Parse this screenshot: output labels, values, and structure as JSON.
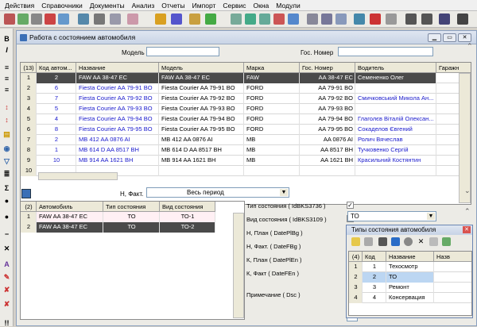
{
  "menu": [
    "Действия",
    "Справочники",
    "Документы",
    "Анализ",
    "Отчеты",
    "Импорт",
    "Сервис",
    "Окна",
    "Модули"
  ],
  "window": {
    "title": "Работа с состоянием автомобиля"
  },
  "filters": {
    "model_label": "Модель",
    "gos_label": "Гос. Номер",
    "model_value": "",
    "gos_value": ""
  },
  "main_grid": {
    "count": "(13)",
    "columns": [
      "Код автом...",
      "Название",
      "Модель",
      "Марка",
      "Гос. Номер",
      "Водитель",
      "Гаражн"
    ],
    "rows": [
      [
        "1",
        "2",
        "FAW AA 38-47 EC",
        "FAW AA 38-47 EC",
        "FAW",
        "AA 38-47 EC",
        "Семененко Олег"
      ],
      [
        "2",
        "6",
        "Fiesta Courier AA 79-91 BO",
        "Fiesta Courier AA 79-91 BO",
        "FORD",
        "AA 79-91 BO",
        ""
      ],
      [
        "3",
        "7",
        "Fiesta Courier AA 79-92 BO",
        "Fiesta Courier AA 79-92 BO",
        "FORD",
        "AA 79-92 BO",
        "Смичковський Микола Ан..."
      ],
      [
        "4",
        "5",
        "Fiesta Courier AA 79-93 BO",
        "Fiesta Courier AA 79-93 BO",
        "FORD",
        "AA 79-93 BO",
        ""
      ],
      [
        "5",
        "4",
        "Fiesta Courier AA 79-94 BO",
        "Fiesta Courier AA 79-94 BO",
        "FORD",
        "AA 79-94 BO",
        "Глаголєв Віталій Олексан..."
      ],
      [
        "6",
        "8",
        "Fiesta Courier AA 79-95 BO",
        "Fiesta Courier AA 79-95 BO",
        "FORD",
        "AA 79-95 BO",
        "Сокаделов Євгений"
      ],
      [
        "7",
        "2",
        "MB 412 AA 0876 AI",
        "MB 412 AA 0876 AI",
        "MB",
        "AA 0876 AI",
        "Ролич Вячеслав"
      ],
      [
        "8",
        "1",
        "MB 614 D AA 8517 BH",
        "MB 614 D AA 8517 BH",
        "MB",
        "AA 8517 BH",
        "Тучковенко Сергій"
      ],
      [
        "9",
        "10",
        "MB 914 AA 1621 BH",
        "MB 914 AA 1621 BH",
        "MB",
        "AA 1621 BH",
        "Красильний Костянтин"
      ],
      [
        "10",
        "",
        "",
        "",
        "",
        "",
        ""
      ]
    ]
  },
  "period": {
    "label": "Н, Факт.",
    "value": "Весь период"
  },
  "state_grid": {
    "count": "(2)",
    "columns": [
      "Автомобиль",
      "Тип состояния",
      "Вид состояния"
    ],
    "rows": [
      [
        "1",
        "FAW AA 38-47 EC",
        "ТО",
        "ТО-1"
      ],
      [
        "2",
        "FAW AA 38-47 EC",
        "ТО",
        "ТО-2"
      ]
    ]
  },
  "form": {
    "fields": [
      "Тип состояния ( IdBKS3736 )",
      "Вид состояния ( IdBKS3109 )",
      "Н, План ( DatePlBg )",
      "Н, Факт. ( DateFBg )",
      "К, План ( DatePlEn )",
      "К, Факт ( DateFEn )",
      "Примечание ( Dsc )"
    ],
    "type_value": "ТО"
  },
  "popup": {
    "title": "Типы состояния автомобиля",
    "count": "(4)",
    "columns": [
      "Код",
      "Название",
      "Назв"
    ],
    "rows": [
      [
        "1",
        "1",
        "Техосмотр"
      ],
      [
        "2",
        "2",
        "ТО"
      ],
      [
        "3",
        "3",
        "Ремонт"
      ],
      [
        "4",
        "4",
        "Консервация"
      ]
    ]
  }
}
